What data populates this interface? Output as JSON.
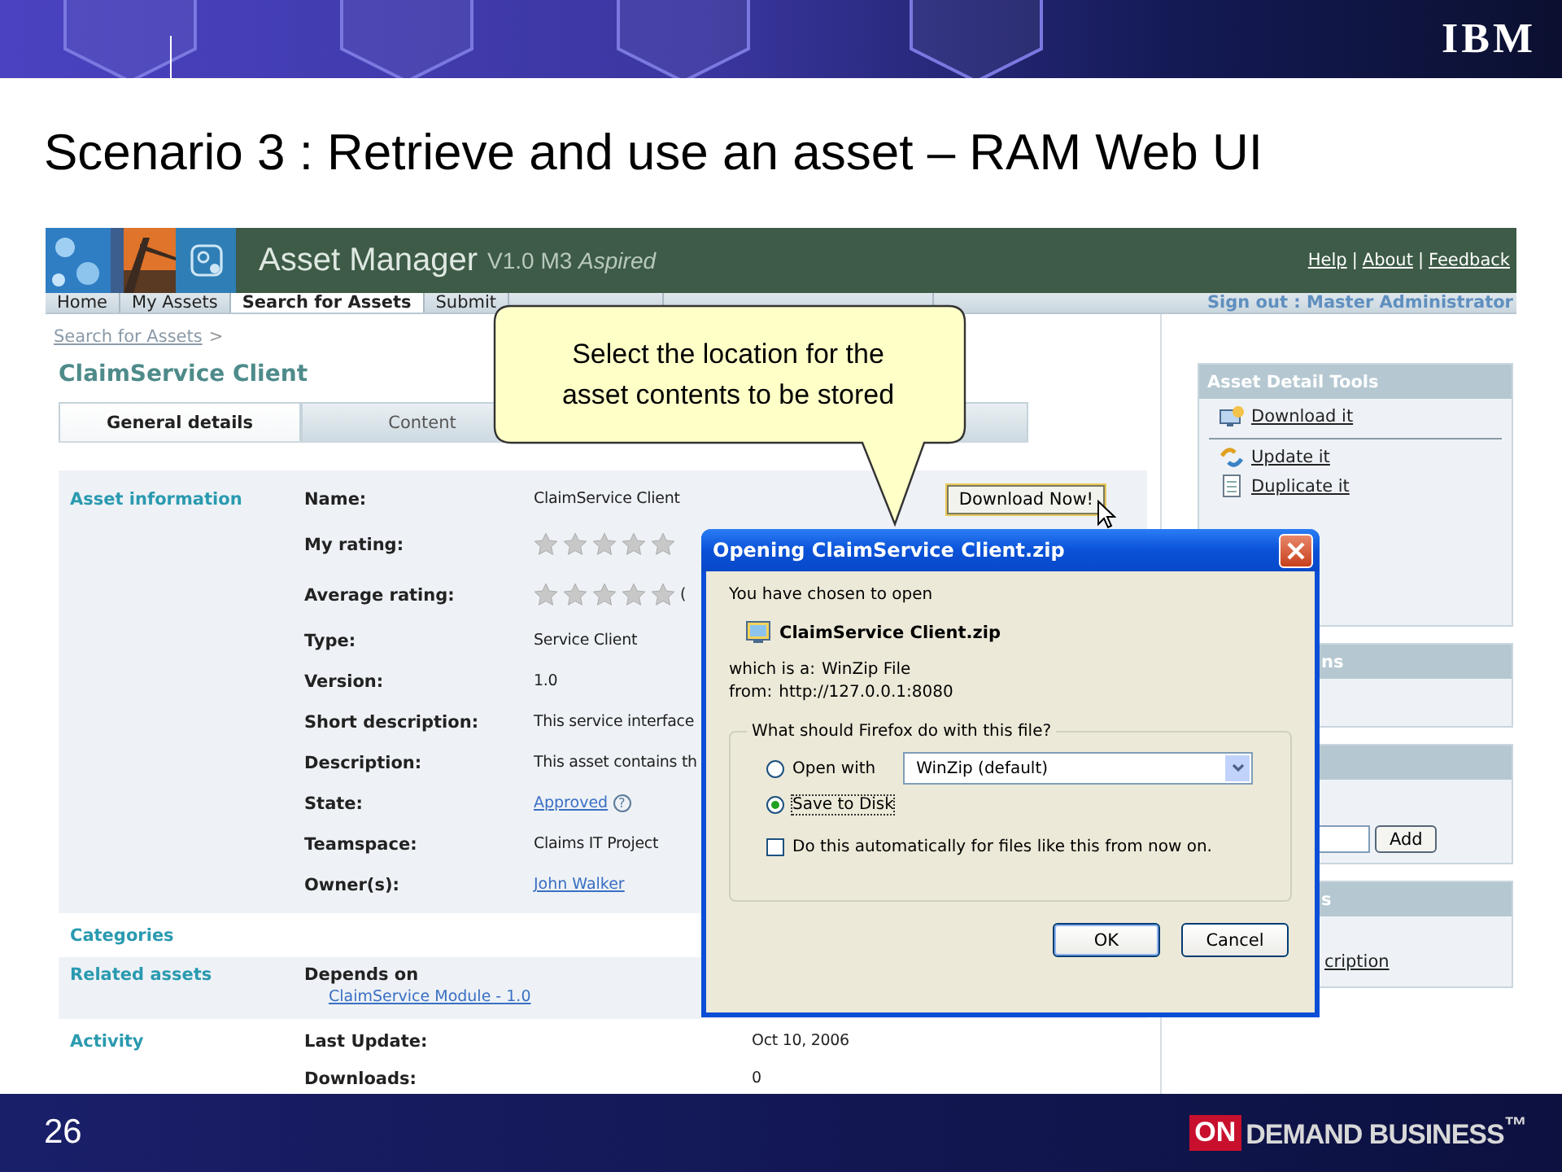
{
  "slide": {
    "logo": "IBM",
    "title": "Scenario 3 : Retrieve and use an asset – RAM Web UI",
    "page_number": "26",
    "brand": {
      "tag": "ON",
      "text": "DEMAND BUSINESS",
      "mark": "™"
    }
  },
  "app": {
    "name": "Asset Manager",
    "version": "V1.0 M3",
    "release": "Aspired",
    "header_links": [
      "Help",
      "About",
      "Feedback"
    ],
    "link_separator": "|",
    "nav_tabs": [
      {
        "label": "Home",
        "selected": false
      },
      {
        "label": "My Assets",
        "selected": false
      },
      {
        "label": "Search for Assets",
        "selected": true
      },
      {
        "label": "Submit",
        "selected": false
      }
    ],
    "sign_out": "Sign out : Master Administrator"
  },
  "breadcrumb": {
    "link": "Search for Assets",
    "separator": ">"
  },
  "asset_title": "ClaimService Client",
  "detail_tabs": [
    {
      "label": "General details",
      "selected": true
    },
    {
      "label": "Content",
      "selected": false
    }
  ],
  "asset_information": {
    "heading": "Asset information",
    "download_button": "Download Now!",
    "fields": [
      {
        "kind": "text",
        "label": "Name:",
        "value": "ClaimService Client"
      },
      {
        "kind": "rating",
        "label": "My rating:",
        "stars": 0
      },
      {
        "kind": "rating",
        "label": "Average rating:",
        "stars": 0,
        "count": "("
      },
      {
        "kind": "text",
        "label": "Type:",
        "value": "Service Client"
      },
      {
        "kind": "text",
        "label": "Version:",
        "value": "1.0"
      },
      {
        "kind": "text",
        "label": "Short description:",
        "value": "This service interface"
      },
      {
        "kind": "text",
        "label": "Description:",
        "value": "This asset contains th"
      },
      {
        "kind": "link",
        "label": "State:",
        "value": "Approved",
        "help": "?"
      },
      {
        "kind": "text",
        "label": "Teamspace:",
        "value": "Claims IT Project"
      },
      {
        "kind": "link",
        "label": "Owner(s):",
        "value": "John Walker"
      }
    ]
  },
  "categories": {
    "heading": "Categories"
  },
  "related_assets": {
    "heading": "Related assets",
    "relation": "Depends on",
    "link": "ClaimService Module - 1.0"
  },
  "activity": {
    "heading": "Activity",
    "fields": [
      {
        "label": "Last Update:",
        "value": "Oct 10, 2006"
      },
      {
        "label": "Downloads:",
        "value": "0"
      }
    ]
  },
  "sidebar": {
    "panels": [
      {
        "kind": "tools",
        "title": "Asset Detail Tools",
        "groups": [
          [
            {
              "kind": "download",
              "label": "Download it"
            }
          ],
          [
            {
              "kind": "update",
              "label": "Update it"
            },
            {
              "kind": "duplicate",
              "label": "Duplicate it"
            }
          ]
        ]
      },
      {
        "kind": "plain",
        "title": "ns"
      },
      {
        "kind": "form",
        "add_button": "Add"
      },
      {
        "kind": "links",
        "title": "s",
        "link": "cription"
      }
    ]
  },
  "callout": {
    "lines": [
      "Select the location for the",
      "asset contents to be stored"
    ]
  },
  "dialog": {
    "title": "Opening ClaimService Client.zip",
    "intro": "You have chosen to open",
    "file_name": "ClaimService Client.zip",
    "type_label": "which is a:",
    "type_value": "WinZip File",
    "from_label": "from:",
    "from_value": "http://127.0.0.1:8080",
    "question": "What should Firefox do with this file?",
    "options": [
      {
        "label": "Open with",
        "selected": false
      },
      {
        "label": "Save to Disk",
        "selected": true
      }
    ],
    "open_with_app": "WinZip (default)",
    "auto": {
      "label": "Do this automatically for files like this from now on.",
      "checked": false
    },
    "buttons": [
      "OK",
      "Cancel"
    ]
  }
}
